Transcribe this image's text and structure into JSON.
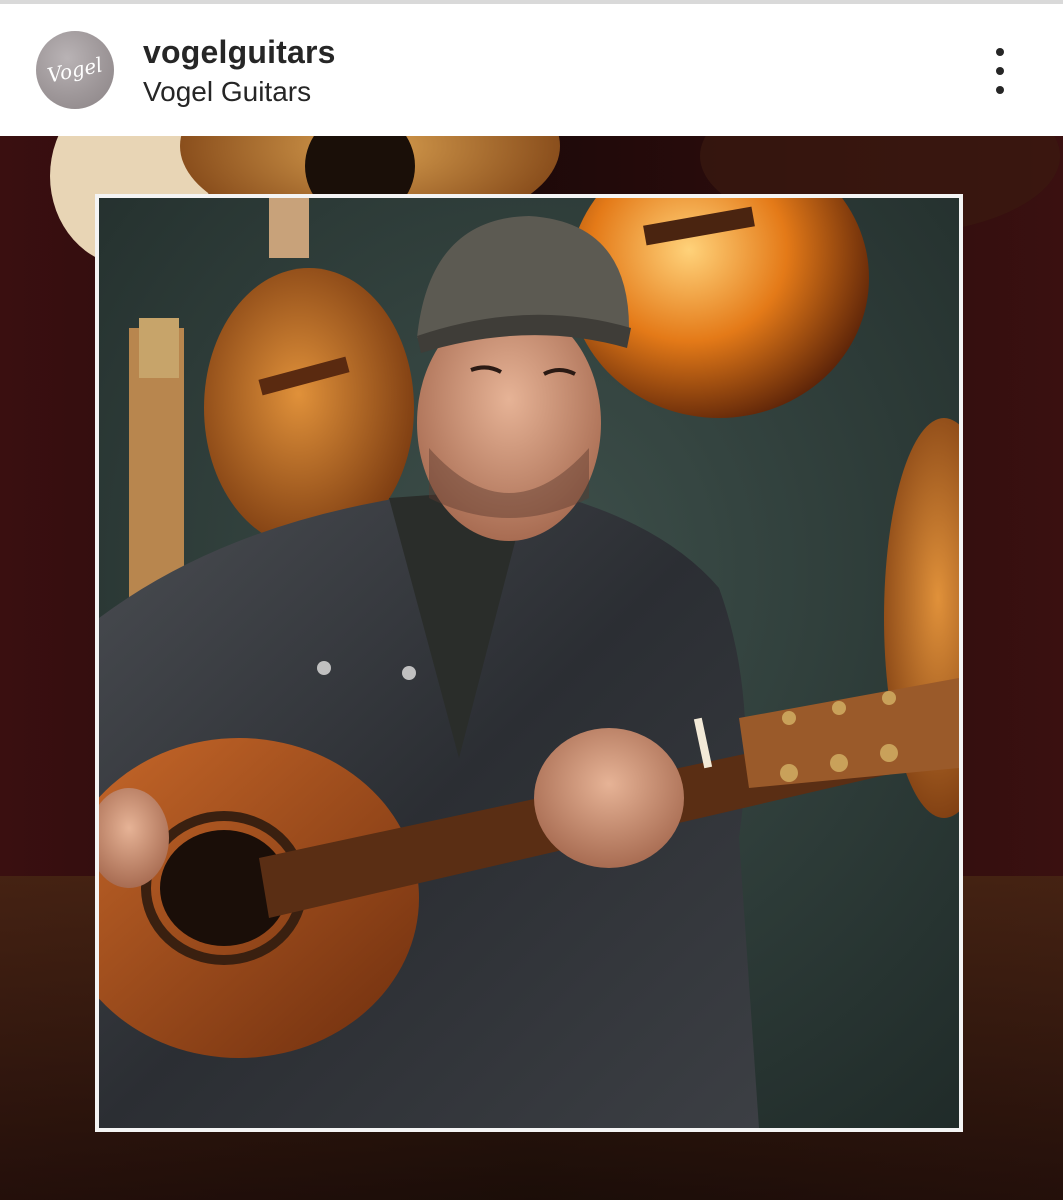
{
  "post": {
    "username": "vogelguitars",
    "display_name": "Vogel Guitars",
    "avatar": {
      "logo_text": "Vogel"
    },
    "more_icon": "more-vertical-icon",
    "image": {
      "description_icon": "photo"
    }
  },
  "colors": {
    "text": "#262626",
    "avatar_bg": "#9e9799",
    "frame": "#f4f4f4",
    "backdrop": "#1a0c0c"
  }
}
